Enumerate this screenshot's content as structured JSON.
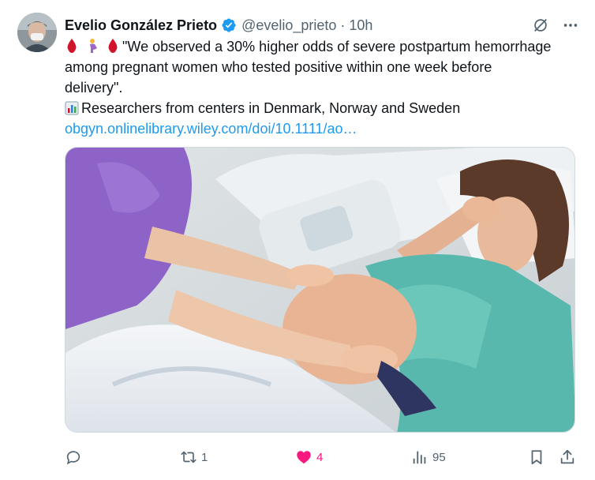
{
  "tweet": {
    "author": {
      "name": "Evelio González Prieto",
      "handle": "@evelio_prieto",
      "verified": true
    },
    "time": "10h",
    "separator": "·",
    "text_lines": [
      "\"We observed a 30% higher odds of severe postpartum hemorrhage",
      "among pregnant women who tested positive within one week before",
      "delivery\"."
    ],
    "text_line4": "Researchers from centers in Denmark, Norway and Sweden",
    "link": "obgyn.onlinelibrary.wiley.com/doi/10.1111/ao…",
    "emojis": [
      "drop-of-blood",
      "pregnant-woman",
      "drop-of-blood",
      "bar-chart"
    ],
    "media": {
      "kind": "photo"
    }
  },
  "actions": {
    "reply": {
      "icon": "reply-icon",
      "count": ""
    },
    "retweet": {
      "icon": "retweet-icon",
      "count": "1"
    },
    "like": {
      "icon": "heart-icon",
      "count": "4",
      "active": true
    },
    "views": {
      "icon": "views-icon",
      "count": "95"
    },
    "bookmark": {
      "icon": "bookmark-icon"
    },
    "share": {
      "icon": "share-icon"
    }
  },
  "colors": {
    "accent": "#1d9bf0",
    "like": "#f91880",
    "muted": "#536471",
    "verified": "#1d9bf0"
  }
}
